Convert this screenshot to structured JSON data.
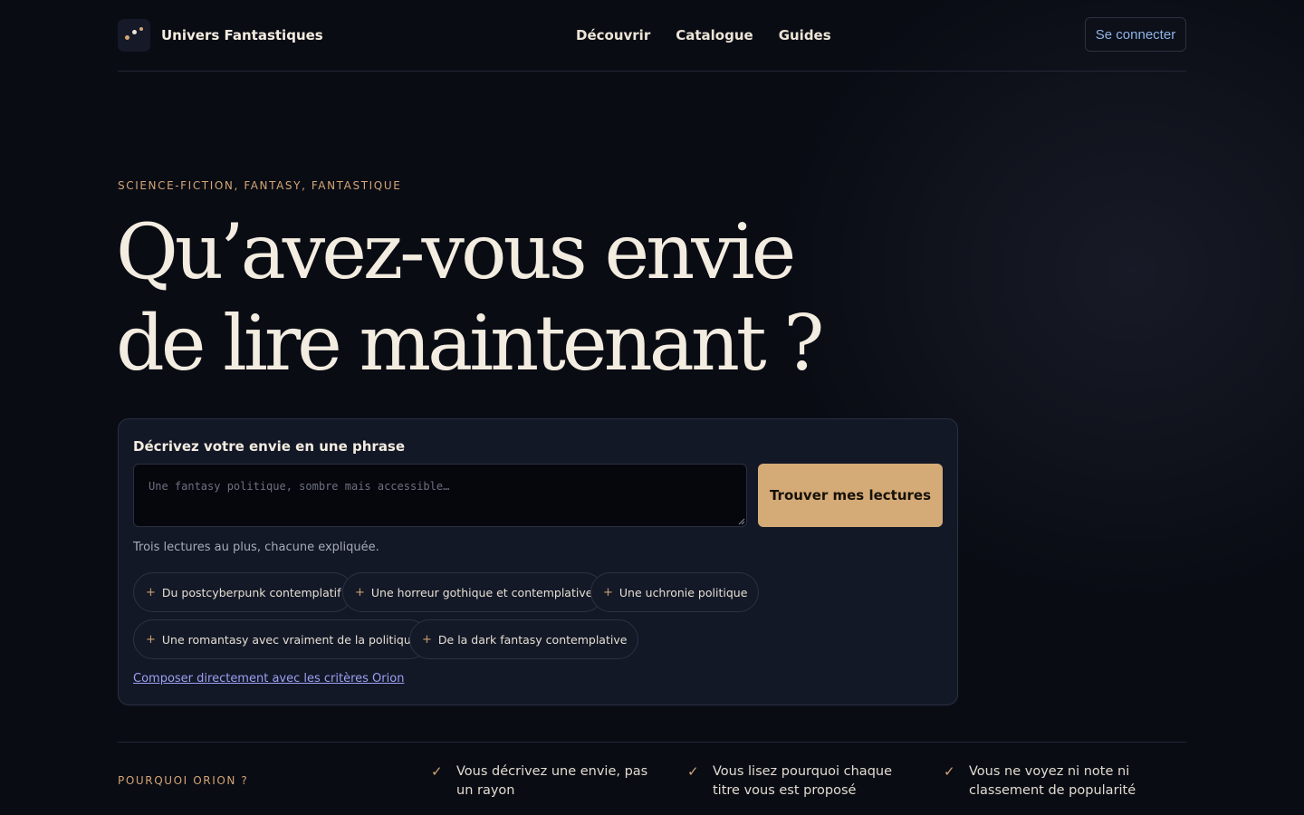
{
  "header": {
    "brand": "Univers Fantastiques",
    "nav": [
      "Découvrir",
      "Catalogue",
      "Guides"
    ],
    "login_label": "Se connecter"
  },
  "hero": {
    "eyebrow": "SCIENCE-FICTION, FANTASY, FANTASTIQUE",
    "title_line1": "Qu’avez-vous envie",
    "title_line2": "de lire maintenant ?"
  },
  "search": {
    "label": "Décrivez votre envie en une phrase",
    "placeholder": "Une fantasy politique, sombre mais accessible…",
    "value": "",
    "submit_label": "Trouver mes lectures",
    "helper": "Trois lectures au plus, chacune expliquée.",
    "chip_icon": "plus-icon",
    "chip_icon_glyph": "+",
    "suggestions": [
      "Du postcyberpunk contemplatif",
      "Une horreur gothique et contemplative",
      "Une uchronie politique",
      "Une romantasy avec vraiment de la politique",
      "De la dark fantasy contemplative"
    ],
    "criteria_link": "Composer directement avec les critères Orion"
  },
  "why": {
    "label": "POURQUOI ORION ?",
    "check_icon": "check-icon",
    "check_glyph": "✓",
    "items": [
      "Vous décrivez une envie, pas un rayon",
      "Vous lisez pourquoi chaque titre vous est proposé",
      "Vous ne voyez ni note ni classement de popularité"
    ]
  },
  "colors": {
    "background": "#0a0c14",
    "accent": "#d4aa77",
    "card": "#131827",
    "link": "#9ba0f2",
    "login_text": "#8fb4e8"
  }
}
